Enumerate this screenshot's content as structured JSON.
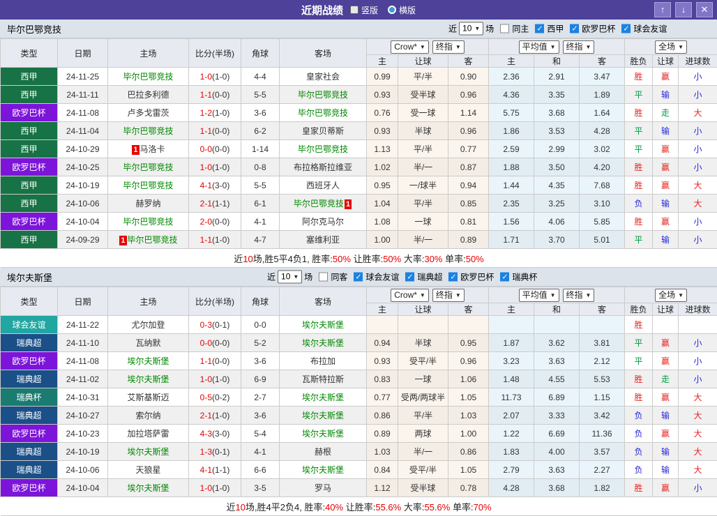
{
  "topbar": {
    "title": "近期战绩",
    "radio_vertical": "竖版",
    "radio_horizontal": "横版",
    "up_icon": "↑",
    "down_icon": "↓",
    "close_icon": "✕"
  },
  "controls": {
    "near_label": "近",
    "count": "10",
    "matches_label": "场"
  },
  "table_header": {
    "cols": [
      "类型",
      "日期",
      "主场",
      "比分(半场)",
      "角球",
      "客场"
    ],
    "crow_select": "Crow*",
    "final_select": "终指",
    "avg_select": "平均值",
    "full_select": "全场",
    "crow_sub": [
      "主",
      "让球",
      "客"
    ],
    "avg_sub": [
      "主",
      "和",
      "客"
    ],
    "result_sub": [
      "胜负",
      "让球",
      "进球数"
    ]
  },
  "league_colors": {
    "西甲": "#177245",
    "欧罗巴杯": "#7D14D9",
    "球会友谊": "#21A6A1",
    "瑞典超": "#1A4F87",
    "瑞典杯": "#1A7B70"
  },
  "result_colors": {
    "胜": "r-red",
    "平": "r-green",
    "负": "r-blue",
    "赢": "r-red",
    "输": "r-blue",
    "走": "r-green",
    "大": "r-red",
    "小": "r-blue"
  },
  "sections": [
    {
      "team": "毕尔巴鄂竞技",
      "filters": {
        "same_label": "同主",
        "same_checked": false,
        "leagues": [
          {
            "label": "西甲",
            "checked": true
          },
          {
            "label": "欧罗巴杯",
            "checked": true
          },
          {
            "label": "球会友谊",
            "checked": true
          }
        ]
      },
      "rows": [
        {
          "league": "西甲",
          "date": "24-11-25",
          "home": "毕尔巴鄂竞技",
          "home_hl": true,
          "home_card": "",
          "score": "1-0",
          "half": "(1-0)",
          "corner": "4-4",
          "away": "皇家社会",
          "away_hl": false,
          "away_card": "",
          "odds": [
            "0.99",
            "平/半",
            "0.90"
          ],
          "avg": [
            "2.36",
            "2.91",
            "3.47"
          ],
          "res": [
            "胜",
            "赢",
            "小"
          ]
        },
        {
          "league": "西甲",
          "date": "24-11-11",
          "home": "巴拉多利德",
          "home_hl": false,
          "home_card": "",
          "score": "1-1",
          "half": "(0-0)",
          "corner": "5-5",
          "away": "毕尔巴鄂竞技",
          "away_hl": true,
          "away_card": "",
          "odds": [
            "0.93",
            "受半球",
            "0.96"
          ],
          "avg": [
            "4.36",
            "3.35",
            "1.89"
          ],
          "res": [
            "平",
            "输",
            "小"
          ]
        },
        {
          "league": "欧罗巴杯",
          "date": "24-11-08",
          "home": "卢多戈雷茨",
          "home_hl": false,
          "home_card": "",
          "score": "1-2",
          "half": "(1-0)",
          "corner": "3-6",
          "away": "毕尔巴鄂竞技",
          "away_hl": true,
          "away_card": "",
          "odds": [
            "0.76",
            "受一球",
            "1.14"
          ],
          "avg": [
            "5.75",
            "3.68",
            "1.64"
          ],
          "res": [
            "胜",
            "走",
            "大"
          ]
        },
        {
          "league": "西甲",
          "date": "24-11-04",
          "home": "毕尔巴鄂竞技",
          "home_hl": true,
          "home_card": "",
          "score": "1-1",
          "half": "(0-0)",
          "corner": "6-2",
          "away": "皇家贝蒂斯",
          "away_hl": false,
          "away_card": "",
          "odds": [
            "0.93",
            "半球",
            "0.96"
          ],
          "avg": [
            "1.86",
            "3.53",
            "4.28"
          ],
          "res": [
            "平",
            "输",
            "小"
          ]
        },
        {
          "league": "西甲",
          "date": "24-10-29",
          "home": "马洛卡",
          "home_hl": false,
          "home_card": "before",
          "score": "0-0",
          "half": "(0-0)",
          "corner": "1-14",
          "away": "毕尔巴鄂竞技",
          "away_hl": true,
          "away_card": "",
          "odds": [
            "1.13",
            "平/半",
            "0.77"
          ],
          "avg": [
            "2.59",
            "2.99",
            "3.02"
          ],
          "res": [
            "平",
            "赢",
            "小"
          ]
        },
        {
          "league": "欧罗巴杯",
          "date": "24-10-25",
          "home": "毕尔巴鄂竞技",
          "home_hl": true,
          "home_card": "",
          "score": "1-0",
          "half": "(1-0)",
          "corner": "0-8",
          "away": "布拉格斯拉维亚",
          "away_hl": false,
          "away_card": "",
          "odds": [
            "1.02",
            "半/一",
            "0.87"
          ],
          "avg": [
            "1.88",
            "3.50",
            "4.20"
          ],
          "res": [
            "胜",
            "赢",
            "小"
          ]
        },
        {
          "league": "西甲",
          "date": "24-10-19",
          "home": "毕尔巴鄂竞技",
          "home_hl": true,
          "home_card": "",
          "score": "4-1",
          "half": "(3-0)",
          "corner": "5-5",
          "away": "西班牙人",
          "away_hl": false,
          "away_card": "",
          "odds": [
            "0.95",
            "一/球半",
            "0.94"
          ],
          "avg": [
            "1.44",
            "4.35",
            "7.68"
          ],
          "res": [
            "胜",
            "赢",
            "大"
          ]
        },
        {
          "league": "西甲",
          "date": "24-10-06",
          "home": "赫罗纳",
          "home_hl": false,
          "home_card": "",
          "score": "2-1",
          "half": "(1-1)",
          "corner": "6-1",
          "away": "毕尔巴鄂竞技",
          "away_hl": true,
          "away_card": "after",
          "odds": [
            "1.04",
            "平/半",
            "0.85"
          ],
          "avg": [
            "2.35",
            "3.25",
            "3.10"
          ],
          "res": [
            "负",
            "输",
            "大"
          ]
        },
        {
          "league": "欧罗巴杯",
          "date": "24-10-04",
          "home": "毕尔巴鄂竞技",
          "home_hl": true,
          "home_card": "",
          "score": "2-0",
          "half": "(0-0)",
          "corner": "4-1",
          "away": "阿尔克马尔",
          "away_hl": false,
          "away_card": "",
          "odds": [
            "1.08",
            "一球",
            "0.81"
          ],
          "avg": [
            "1.56",
            "4.06",
            "5.85"
          ],
          "res": [
            "胜",
            "赢",
            "小"
          ]
        },
        {
          "league": "西甲",
          "date": "24-09-29",
          "home": "毕尔巴鄂竞技",
          "home_hl": true,
          "home_card": "before",
          "score": "1-1",
          "half": "(1-0)",
          "corner": "4-7",
          "away": "塞维利亚",
          "away_hl": false,
          "away_card": "",
          "odds": [
            "1.00",
            "半/一",
            "0.89"
          ],
          "avg": [
            "1.71",
            "3.70",
            "5.01"
          ],
          "res": [
            "平",
            "输",
            "小"
          ]
        }
      ],
      "summary": [
        {
          "text": "近",
          "red": false
        },
        {
          "text": "10",
          "red": true
        },
        {
          "text": "场,胜5平4负1, 胜率:",
          "red": false
        },
        {
          "text": "50%",
          "red": true
        },
        {
          "text": " 让胜率:",
          "red": false
        },
        {
          "text": "50%",
          "red": true
        },
        {
          "text": " 大率:",
          "red": false
        },
        {
          "text": "30%",
          "red": true
        },
        {
          "text": " 单率:",
          "red": false
        },
        {
          "text": "50%",
          "red": true
        }
      ]
    },
    {
      "team": "埃尔夫斯堡",
      "filters": {
        "same_label": "同客",
        "same_checked": false,
        "leagues": [
          {
            "label": "球会友谊",
            "checked": true
          },
          {
            "label": "瑞典超",
            "checked": true
          },
          {
            "label": "欧罗巴杯",
            "checked": true
          },
          {
            "label": "瑞典杯",
            "checked": true
          }
        ]
      },
      "rows": [
        {
          "league": "球会友谊",
          "date": "24-11-22",
          "home": "尤尔加登",
          "home_hl": false,
          "home_card": "",
          "score": "0-3",
          "half": "(0-1)",
          "corner": "0-0",
          "away": "埃尔夫斯堡",
          "away_hl": true,
          "away_card": "",
          "odds": [
            "",
            "",
            ""
          ],
          "avg": [
            "",
            "",
            ""
          ],
          "res": [
            "胜",
            "",
            ""
          ]
        },
        {
          "league": "瑞典超",
          "date": "24-11-10",
          "home": "瓦纳默",
          "home_hl": false,
          "home_card": "",
          "score": "0-0",
          "half": "(0-0)",
          "corner": "5-2",
          "away": "埃尔夫斯堡",
          "away_hl": true,
          "away_card": "",
          "odds": [
            "0.94",
            "半球",
            "0.95"
          ],
          "avg": [
            "1.87",
            "3.62",
            "3.81"
          ],
          "res": [
            "平",
            "赢",
            "小"
          ]
        },
        {
          "league": "欧罗巴杯",
          "date": "24-11-08",
          "home": "埃尔夫斯堡",
          "home_hl": true,
          "home_card": "",
          "score": "1-1",
          "half": "(0-0)",
          "corner": "3-6",
          "away": "布拉加",
          "away_hl": false,
          "away_card": "",
          "odds": [
            "0.93",
            "受平/半",
            "0.96"
          ],
          "avg": [
            "3.23",
            "3.63",
            "2.12"
          ],
          "res": [
            "平",
            "赢",
            "小"
          ]
        },
        {
          "league": "瑞典超",
          "date": "24-11-02",
          "home": "埃尔夫斯堡",
          "home_hl": true,
          "home_card": "",
          "score": "1-0",
          "half": "(1-0)",
          "corner": "6-9",
          "away": "瓦斯特拉斯",
          "away_hl": false,
          "away_card": "",
          "odds": [
            "0.83",
            "一球",
            "1.06"
          ],
          "avg": [
            "1.48",
            "4.55",
            "5.53"
          ],
          "res": [
            "胜",
            "走",
            "小"
          ]
        },
        {
          "league": "瑞典杯",
          "date": "24-10-31",
          "home": "艾斯基斯迈",
          "home_hl": false,
          "home_card": "",
          "score": "0-5",
          "half": "(0-2)",
          "corner": "2-7",
          "away": "埃尔夫斯堡",
          "away_hl": true,
          "away_card": "",
          "odds": [
            "0.77",
            "受两/两球半",
            "1.05"
          ],
          "avg": [
            "11.73",
            "6.89",
            "1.15"
          ],
          "res": [
            "胜",
            "赢",
            "大"
          ]
        },
        {
          "league": "瑞典超",
          "date": "24-10-27",
          "home": "索尔纳",
          "home_hl": false,
          "home_card": "",
          "score": "2-1",
          "half": "(1-0)",
          "corner": "3-6",
          "away": "埃尔夫斯堡",
          "away_hl": true,
          "away_card": "",
          "odds": [
            "0.86",
            "平/半",
            "1.03"
          ],
          "avg": [
            "2.07",
            "3.33",
            "3.42"
          ],
          "res": [
            "负",
            "输",
            "大"
          ]
        },
        {
          "league": "欧罗巴杯",
          "date": "24-10-23",
          "home": "加拉塔萨雷",
          "home_hl": false,
          "home_card": "",
          "score": "4-3",
          "half": "(3-0)",
          "corner": "5-4",
          "away": "埃尔夫斯堡",
          "away_hl": true,
          "away_card": "",
          "odds": [
            "0.89",
            "两球",
            "1.00"
          ],
          "avg": [
            "1.22",
            "6.69",
            "11.36"
          ],
          "res": [
            "负",
            "赢",
            "大"
          ]
        },
        {
          "league": "瑞典超",
          "date": "24-10-19",
          "home": "埃尔夫斯堡",
          "home_hl": true,
          "home_card": "",
          "score": "1-3",
          "half": "(0-1)",
          "corner": "4-1",
          "away": "赫根",
          "away_hl": false,
          "away_card": "",
          "odds": [
            "1.03",
            "半/一",
            "0.86"
          ],
          "avg": [
            "1.83",
            "4.00",
            "3.57"
          ],
          "res": [
            "负",
            "输",
            "大"
          ]
        },
        {
          "league": "瑞典超",
          "date": "24-10-06",
          "home": "天狼星",
          "home_hl": false,
          "home_card": "",
          "score": "4-1",
          "half": "(1-1)",
          "corner": "6-6",
          "away": "埃尔夫斯堡",
          "away_hl": true,
          "away_card": "",
          "odds": [
            "0.84",
            "受平/半",
            "1.05"
          ],
          "avg": [
            "2.79",
            "3.63",
            "2.27"
          ],
          "res": [
            "负",
            "输",
            "大"
          ]
        },
        {
          "league": "欧罗巴杯",
          "date": "24-10-04",
          "home": "埃尔夫斯堡",
          "home_hl": true,
          "home_card": "",
          "score": "1-0",
          "half": "(1-0)",
          "corner": "3-5",
          "away": "罗马",
          "away_hl": false,
          "away_card": "",
          "odds": [
            "1.12",
            "受半球",
            "0.78"
          ],
          "avg": [
            "4.28",
            "3.68",
            "1.82"
          ],
          "res": [
            "胜",
            "赢",
            "小"
          ]
        }
      ],
      "summary": [
        {
          "text": "近",
          "red": false
        },
        {
          "text": "10",
          "red": true
        },
        {
          "text": "场,胜4平2负4, 胜率:",
          "red": false
        },
        {
          "text": "40%",
          "red": true
        },
        {
          "text": " 让胜率:",
          "red": false
        },
        {
          "text": "55.6%",
          "red": true
        },
        {
          "text": " 大率:",
          "red": false
        },
        {
          "text": "55.6%",
          "red": true
        },
        {
          "text": " 单率:",
          "red": false
        },
        {
          "text": "70%",
          "red": true
        }
      ]
    }
  ]
}
